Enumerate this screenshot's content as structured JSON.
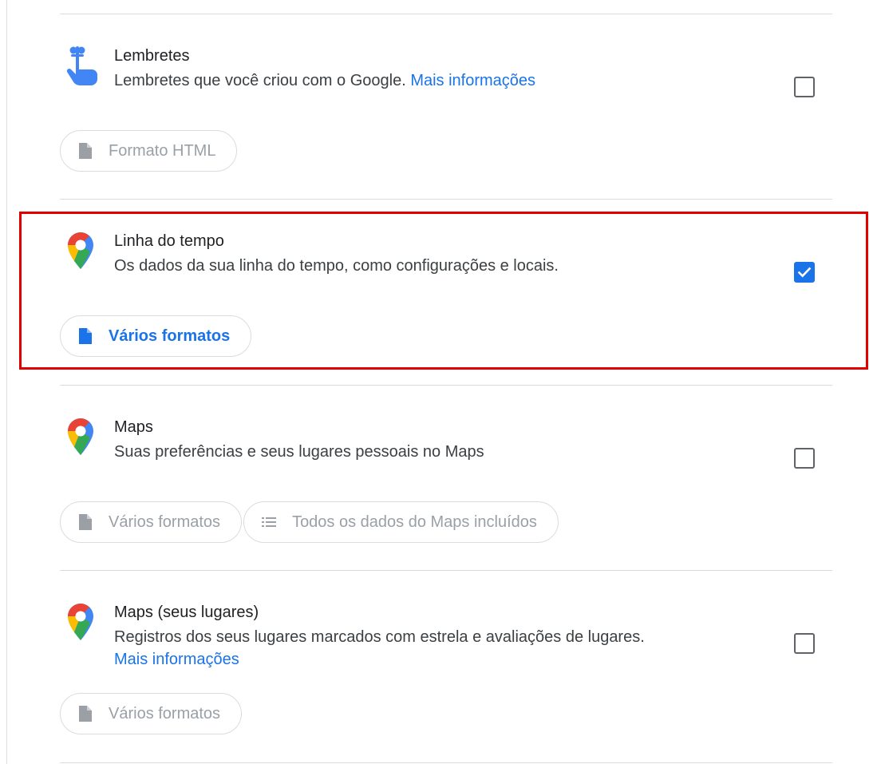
{
  "products": [
    {
      "id": "lembretes",
      "icon": "reminder-hand-icon",
      "title": "Lembretes",
      "description": "Lembretes que você criou com o Google.",
      "link_text": "Mais informações",
      "checked": false,
      "chips": [
        {
          "icon": "file-icon",
          "label": "Formato HTML",
          "active": false
        }
      ]
    },
    {
      "id": "linha-do-tempo",
      "icon": "maps-pin-icon",
      "title": "Linha do tempo",
      "description": "Os dados da sua linha do tempo, como configurações e locais.",
      "link_text": "",
      "checked": true,
      "chips": [
        {
          "icon": "file-icon",
          "label": "Vários formatos",
          "active": true
        }
      ]
    },
    {
      "id": "maps",
      "icon": "maps-pin-icon",
      "title": "Maps",
      "description": "Suas preferências e seus lugares pessoais no Maps",
      "link_text": "",
      "checked": false,
      "chips": [
        {
          "icon": "file-icon",
          "label": "Vários formatos",
          "active": false
        },
        {
          "icon": "list-icon",
          "label": "Todos os dados do Maps incluídos",
          "active": false
        }
      ]
    },
    {
      "id": "maps-seus-lugares",
      "icon": "maps-pin-icon",
      "title": "Maps (seus lugares)",
      "description": "Registros dos seus lugares marcados com estrela e avaliações de lugares.",
      "link_text": "Mais informações",
      "checked": false,
      "chips": [
        {
          "icon": "file-icon",
          "label": "Vários formatos",
          "active": false
        }
      ]
    }
  ],
  "colors": {
    "accent": "#1a73e8",
    "highlight_border": "#e00000",
    "divider": "#dadce0",
    "muted_text": "#9aa0a6"
  }
}
